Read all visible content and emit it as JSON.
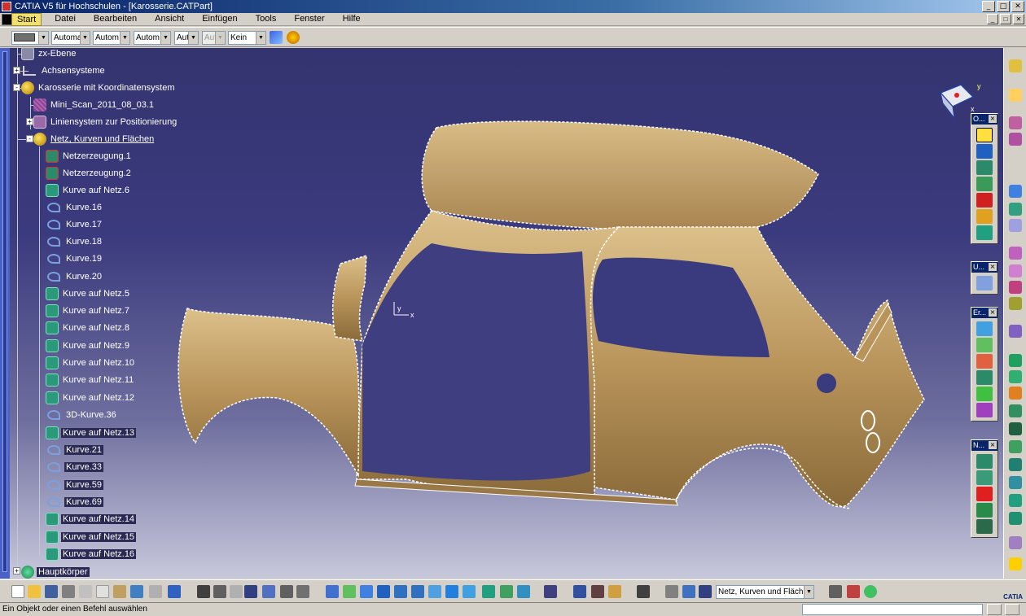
{
  "window": {
    "title": "CATIA V5 für Hochschulen - [Karosserie.CATPart]",
    "minimize": "_",
    "maximize": "□",
    "close": "✕"
  },
  "menubar": {
    "items": [
      "Start",
      "Datei",
      "Bearbeiten",
      "Ansicht",
      "Einfügen",
      "Tools",
      "Fenster",
      "Hilfe"
    ]
  },
  "property_toolbar": {
    "color_combo": "",
    "combos": [
      "Automa",
      "Autom",
      "Autom",
      "Aut",
      "Aut",
      "Kein"
    ]
  },
  "tree": {
    "items": [
      {
        "label": "zx-Ebene",
        "icon": "plane-icon"
      },
      {
        "label": "Achsensysteme",
        "icon": "axis-icon"
      },
      {
        "label": "Karosserie mit Koordinatensystem",
        "icon": "geometric-set-icon"
      },
      {
        "label": "Mini_Scan_2011_08_03.1",
        "icon": "cloud-scan-icon"
      },
      {
        "label": "Liniensystem zur Positionierung",
        "icon": "lines-icon"
      },
      {
        "label": "Netz, Kurven und Flächen",
        "icon": "geometric-set-icon"
      },
      {
        "label": "Netzerzeugung.1",
        "icon": "mesh-creation-icon"
      },
      {
        "label": "Netzerzeugung.2",
        "icon": "mesh-creation-icon"
      },
      {
        "label": "Kurve auf Netz.6",
        "icon": "curve-on-mesh-icon"
      },
      {
        "label": "Kurve.16",
        "icon": "curve-icon"
      },
      {
        "label": "Kurve.17",
        "icon": "curve-icon"
      },
      {
        "label": "Kurve.18",
        "icon": "curve-icon"
      },
      {
        "label": "Kurve.19",
        "icon": "curve-icon"
      },
      {
        "label": "Kurve.20",
        "icon": "curve-icon"
      },
      {
        "label": "Kurve auf Netz.5",
        "icon": "curve-on-mesh-icon"
      },
      {
        "label": "Kurve auf Netz.7",
        "icon": "curve-on-mesh-icon"
      },
      {
        "label": "Kurve auf Netz.8",
        "icon": "curve-on-mesh-icon"
      },
      {
        "label": "Kurve auf Netz.9",
        "icon": "curve-on-mesh-icon"
      },
      {
        "label": "Kurve auf Netz.10",
        "icon": "curve-on-mesh-icon"
      },
      {
        "label": "Kurve auf Netz.11",
        "icon": "curve-on-mesh-icon"
      },
      {
        "label": "Kurve auf Netz.12",
        "icon": "curve-on-mesh-icon"
      },
      {
        "label": "3D-Kurve.36",
        "icon": "curve-icon"
      },
      {
        "label": "Kurve auf Netz.13",
        "icon": "curve-on-mesh-icon"
      },
      {
        "label": "Kurve.21",
        "icon": "curve-icon"
      },
      {
        "label": "Kurve.33",
        "icon": "curve-icon"
      },
      {
        "label": "Kurve.59",
        "icon": "curve-icon"
      },
      {
        "label": "Kurve.69",
        "icon": "curve-icon"
      },
      {
        "label": "Kurve auf Netz.14",
        "icon": "curve-on-mesh-icon"
      },
      {
        "label": "Kurve auf Netz.15",
        "icon": "curve-on-mesh-icon"
      },
      {
        "label": "Kurve auf Netz.16",
        "icon": "curve-on-mesh-icon"
      },
      {
        "label": "Hauptkörper",
        "icon": "part-body-icon"
      }
    ]
  },
  "viewport": {
    "axis_x": "x",
    "axis_y": "y",
    "compass_y": "y",
    "compass_x": "x"
  },
  "palettes": [
    {
      "title": "O...",
      "close": "×"
    },
    {
      "title": "U...",
      "close": "×"
    },
    {
      "title": "Er...",
      "close": "×"
    },
    {
      "title": "N...",
      "close": "×"
    }
  ],
  "bottom_toolbar": {
    "workbench_combo": "Netz, Kurven und Flächen",
    "brand": "CATIA"
  },
  "statusbar": {
    "message": "Ein Objekt oder einen Befehl auswählen",
    "input_value": ""
  },
  "colors": {
    "accent": "#0a246a",
    "viewport_top": "#343470",
    "viewport_bottom": "#c8c8dc",
    "car_body": "#c8a46a"
  }
}
